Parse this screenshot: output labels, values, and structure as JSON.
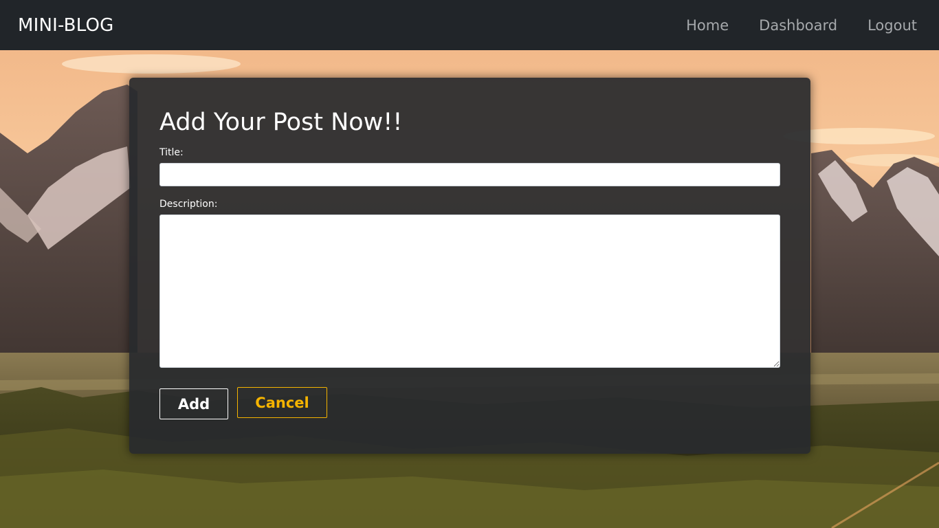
{
  "navbar": {
    "brand": "MINI-BLOG",
    "links": [
      {
        "label": "Home"
      },
      {
        "label": "Dashboard"
      },
      {
        "label": "Logout"
      }
    ]
  },
  "form": {
    "heading": "Add Your Post Now!!",
    "title_label": "Title:",
    "title_value": "",
    "description_label": "Description:",
    "description_value": "",
    "add_label": "Add",
    "cancel_label": "Cancel"
  },
  "colors": {
    "navbar_bg": "#212529",
    "card_bg": "#282a2d",
    "cancel_accent": "#f5b400"
  }
}
